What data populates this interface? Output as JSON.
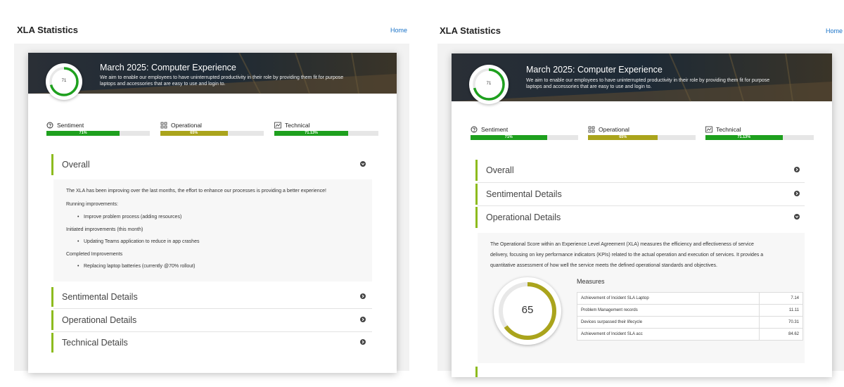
{
  "app": {
    "title": "XLA Statistics",
    "home_label": "Home"
  },
  "colors": {
    "green": "#1ea01e",
    "olive": "#aaa41c",
    "accent": "#8dbb1e",
    "link": "#1a73c8"
  },
  "banner": {
    "title": "March 2025: Computer Experience",
    "description_line1": "We aim to enable our employees to have uninterrupted productivity in their role by providing them fit for purpose",
    "description_line2": "laptops and accessories that are easy to use and login to.",
    "score": "71",
    "score_fraction": 0.71
  },
  "metrics": [
    {
      "label": "Sentiment",
      "value": "71%",
      "fraction": 0.71,
      "icon": "smiley-icon"
    },
    {
      "label": "Operational",
      "value": "65%",
      "fraction": 0.65,
      "icon": "gear-grid-icon"
    },
    {
      "label": "Technical",
      "value": "71.13%",
      "fraction": 0.7113,
      "icon": "chart-icon"
    }
  ],
  "left_panel": {
    "sections": [
      "Overall",
      "Sentimental Details",
      "Operational Details",
      "Technical Details"
    ],
    "overall": {
      "intro": "The XLA has been improving over the last months, the effort to enhance our processes is providing a better experience!",
      "running_heading": "Running improvements:",
      "running_item": "Improve problem process (adding resources)",
      "initiated_heading": "Initiated improvements (this month)",
      "initiated_item": "Updating Teams application to reduce in app crashes",
      "completed_heading": "Completed Improvements",
      "completed_item": "Replacing laptop batteries (currently @70% rollout)"
    }
  },
  "right_panel": {
    "sections": [
      "Overall",
      "Sentimental Details",
      "Operational Details"
    ],
    "operational": {
      "line1": "The Operational Score within an Experience Level Agreement (XLA) measures the efficiency and effectiveness of service",
      "line2": "delivery, focusing on key performance indicators (KPIs) related to the actual operation and execution of services. It provides a",
      "line3": "quantitative assessment of how well the service meets the defined operational standards and objectives.",
      "score": "65",
      "score_fraction": 0.65,
      "measures_title": "Measures",
      "measures": [
        {
          "name": "Achievement of Incident SLA Laptop",
          "value": "7.14"
        },
        {
          "name": "Problem Management records",
          "value": "11.11"
        },
        {
          "name": "Devices surpassed their lifecycle",
          "value": "70.31"
        },
        {
          "name": "Achievement of Incident SLA acc",
          "value": "84.62"
        }
      ]
    }
  }
}
